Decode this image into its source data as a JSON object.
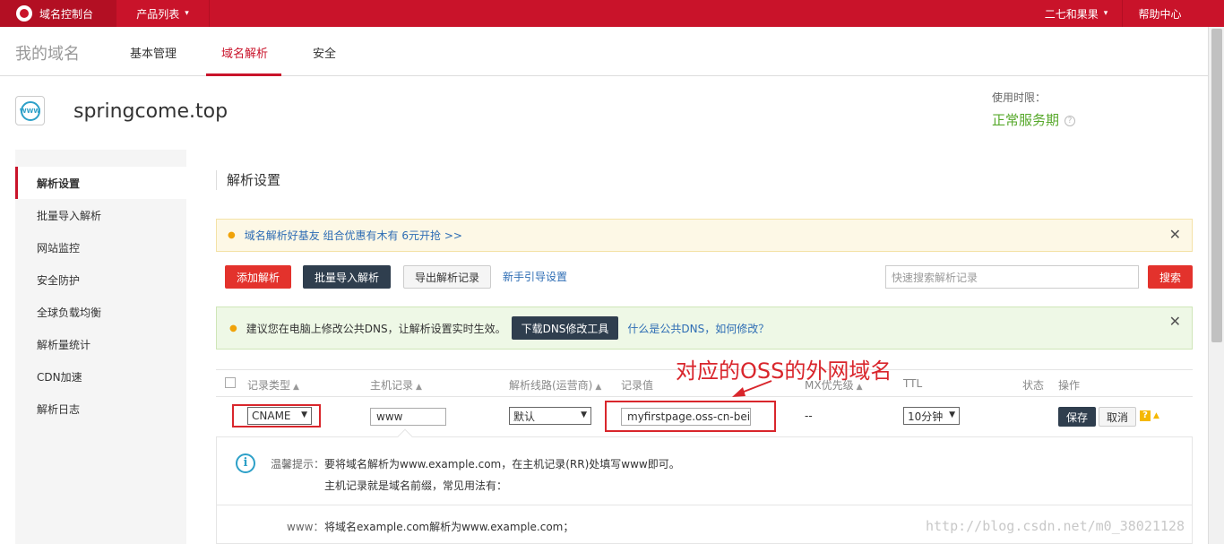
{
  "topbar": {
    "brand": "域名控制台",
    "products": "产品列表",
    "user": "二七和果果",
    "help": "帮助中心",
    "caret": "⌄"
  },
  "nav": {
    "title": "我的域名",
    "tabs": [
      {
        "label": "基本管理",
        "active": false
      },
      {
        "label": "域名解析",
        "active": true
      },
      {
        "label": "安全",
        "active": false
      }
    ]
  },
  "domain": {
    "name": "springcome.top",
    "icon_text": "WWW",
    "use_label": "使用时限：",
    "use_status": "正常服务期"
  },
  "sidebar": {
    "items": [
      {
        "label": "解析设置",
        "active": true
      },
      {
        "label": "批量导入解析",
        "active": false
      },
      {
        "label": "网站监控",
        "active": false
      },
      {
        "label": "安全防护",
        "active": false
      },
      {
        "label": "全球负载均衡",
        "active": false
      },
      {
        "label": "解析量统计",
        "active": false
      },
      {
        "label": "CDN加速",
        "active": false
      },
      {
        "label": "解析日志",
        "active": false
      }
    ]
  },
  "main": {
    "section_title": "解析设置",
    "promo": "域名解析好基友 组合优惠有木有 6元开抢 >>",
    "toolbar": {
      "add": "添加解析",
      "batch_import": "批量导入解析",
      "export": "导出解析记录",
      "guide": "新手引导设置",
      "search_placeholder": "快速搜索解析记录",
      "search": "搜索"
    },
    "dns_notice": {
      "text": "建议您在电脑上修改公共DNS，让解析设置实时生效。",
      "button": "下载DNS修改工具",
      "link": "什么是公共DNS，如何修改？"
    },
    "table": {
      "headers": [
        "记录类型",
        "主机记录",
        "解析线路(运营商)",
        "记录值",
        "MX优先级",
        "TTL",
        "状态",
        "操作"
      ],
      "row": {
        "type": "CNAME",
        "host": "www",
        "line": "默认",
        "value": "myfirstpage.oss-cn-bei",
        "mx": "--",
        "ttl": "10分钟",
        "save": "保存",
        "cancel": "取消",
        "help": "?"
      }
    },
    "annotation": "对应的OSS的外网域名",
    "tip": {
      "label": "温馨提示：",
      "line1": "要将域名解析为www.example.com，在主机记录(RR)处填写www即可。",
      "line2": "主机记录就是域名前缀，常见用法有：",
      "example_key": "www：",
      "example_val": "将域名example.com解析为www.example.com；"
    }
  },
  "watermark": "http://blog.csdn.net/m0_38021128",
  "colors": {
    "brand_red": "#c9132a",
    "button_red": "#e3322c",
    "button_dark": "#2f3e4e",
    "link_blue": "#2e6db4",
    "status_green": "#56a82a",
    "annotation_red": "#d9262c"
  }
}
